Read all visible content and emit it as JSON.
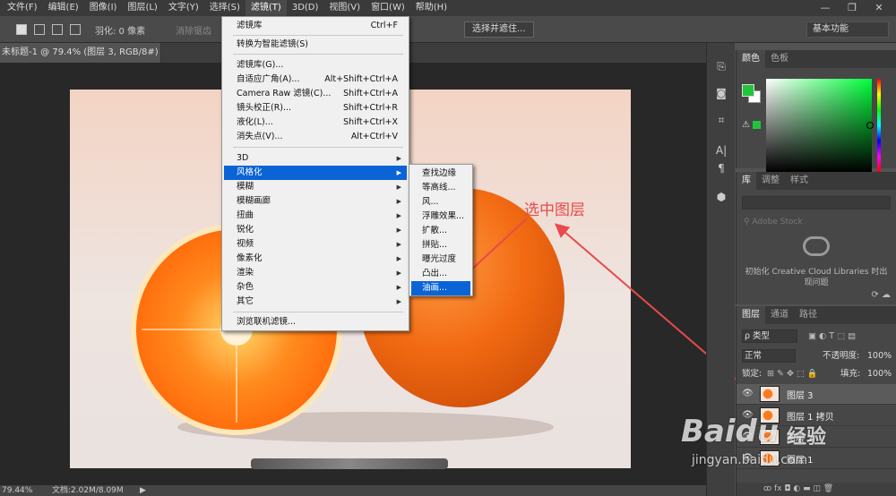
{
  "menubar": {
    "items": [
      "文件(F)",
      "编辑(E)",
      "图像(I)",
      "图层(L)",
      "文字(Y)",
      "选择(S)",
      "滤镜(T)",
      "3D(D)",
      "视图(V)",
      "窗口(W)",
      "帮助(H)"
    ],
    "active_index": 6
  },
  "window_controls": [
    "—",
    "❐",
    "✕"
  ],
  "options_bar": {
    "feather_label": "羽化: 0 像素",
    "antialias_label": "消除锯齿",
    "select_mask_button": "选择并遮住...",
    "workspace": "基本功能"
  },
  "document_tab": {
    "title": "未标题-1 @ 79.4% (图层 3, RGB/8#) *",
    "close": "×"
  },
  "filter_menu": {
    "items": [
      {
        "label": "滤镜库",
        "shortcut": "Ctrl+F"
      },
      {
        "label": "转换为智能滤镜(S)",
        "shortcut": ""
      },
      {
        "label": "滤镜库(G)...",
        "shortcut": ""
      },
      {
        "label": "自适应广角(A)...",
        "shortcut": "Alt+Shift+Ctrl+A"
      },
      {
        "label": "Camera Raw 滤镜(C)...",
        "shortcut": "Shift+Ctrl+A"
      },
      {
        "label": "镜头校正(R)...",
        "shortcut": "Shift+Ctrl+R"
      },
      {
        "label": "液化(L)...",
        "shortcut": "Shift+Ctrl+X"
      },
      {
        "label": "消失点(V)...",
        "shortcut": "Alt+Ctrl+V"
      },
      {
        "label": "3D",
        "shortcut": ""
      },
      {
        "label": "风格化",
        "shortcut": ""
      },
      {
        "label": "模糊",
        "shortcut": ""
      },
      {
        "label": "模糊画廊",
        "shortcut": ""
      },
      {
        "label": "扭曲",
        "shortcut": ""
      },
      {
        "label": "锐化",
        "shortcut": ""
      },
      {
        "label": "视频",
        "shortcut": ""
      },
      {
        "label": "像素化",
        "shortcut": ""
      },
      {
        "label": "渲染",
        "shortcut": ""
      },
      {
        "label": "杂色",
        "shortcut": ""
      },
      {
        "label": "其它",
        "shortcut": ""
      },
      {
        "label": "浏览联机滤镜...",
        "shortcut": ""
      }
    ],
    "submenu_arrow": "▶"
  },
  "stylize_submenu": {
    "items": [
      "查找边缘",
      "等高线...",
      "风...",
      "浮雕效果...",
      "扩散...",
      "拼贴...",
      "曝光过度",
      "凸出...",
      "油画..."
    ],
    "highlighted_index": 8
  },
  "annotation": "选中图层",
  "status": {
    "zoom": "79.44%",
    "doc": "文档:2.02M/8.09M",
    "arrow": "▶"
  },
  "color_panel": {
    "tabs": [
      "颜色",
      "色板"
    ],
    "fg_color": "#22c43a",
    "warn": "⚠"
  },
  "library_panel": {
    "tabs": [
      "库",
      "调整",
      "样式"
    ],
    "search_placeholder": "Adobe Stock",
    "message": "初始化 Creative Cloud Libraries 时出现问题",
    "icons": "⟳ ☁"
  },
  "layers_panel": {
    "tabs": [
      "图层",
      "通道",
      "路径"
    ],
    "kind": "ρ 类型",
    "blend_mode": "正常",
    "opacity_label": "不透明度:",
    "opacity": "100%",
    "lock_label": "锁定:",
    "fill_label": "填充:",
    "fill": "100%",
    "layers": [
      "图层 3",
      "图层 1 拷贝",
      "图层 2",
      "图层 1"
    ],
    "footer": "ꝏ fx ◘ ◐ ▬ ◫ 🗑"
  },
  "watermark": {
    "brand": "Baidu",
    "brand_cn": "经验",
    "url": "jingyan.baidu.com"
  }
}
